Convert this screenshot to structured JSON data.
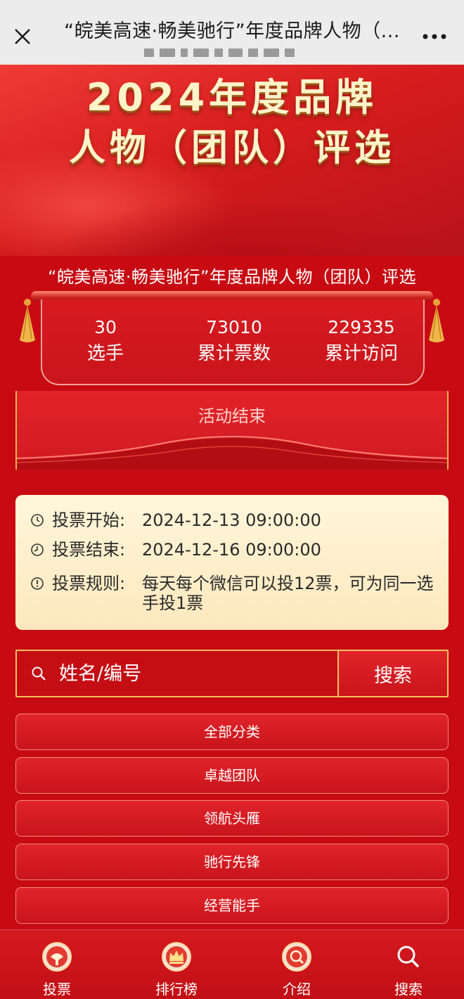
{
  "header": {
    "title": "“皖美高速·畅美驰行”年度品牌人物（...",
    "close_icon": "close-icon",
    "more_icon": "more-icon"
  },
  "banner": {
    "line1": "2024年度品牌",
    "line2": "人物（团队）评选"
  },
  "event": {
    "title": "“皖美高速·畅美驰行”年度品牌人物（团队）评选"
  },
  "stats": [
    {
      "value": "30",
      "label": "选手"
    },
    {
      "value": "73010",
      "label": "累计票数"
    },
    {
      "value": "229335",
      "label": "累计访问"
    }
  ],
  "status": {
    "text": "活动结束"
  },
  "info": {
    "start_label": "投票开始:",
    "start_value": "2024-12-13 09:00:00",
    "end_label": "投票结束:",
    "end_value": "2024-12-16 09:00:00",
    "rule_label": "投票规则:",
    "rule_value": "每天每个微信可以投12票，可为同一选手投1票"
  },
  "search": {
    "placeholder": "姓名/编号",
    "button_label": "搜索"
  },
  "categories": [
    {
      "label": "全部分类"
    },
    {
      "label": "卓越团队"
    },
    {
      "label": "领航头雁"
    },
    {
      "label": "驰行先锋"
    },
    {
      "label": "经营能手"
    }
  ],
  "bottom_nav": [
    {
      "label": "投票",
      "icon": "vote-icon"
    },
    {
      "label": "排行榜",
      "icon": "crown-icon"
    },
    {
      "label": "介绍",
      "icon": "intro-icon"
    },
    {
      "label": "搜索",
      "icon": "search-icon"
    }
  ],
  "colors": {
    "primary_red": "#c80a12",
    "gold": "#f2c260",
    "info_bg": "#fff6da"
  }
}
